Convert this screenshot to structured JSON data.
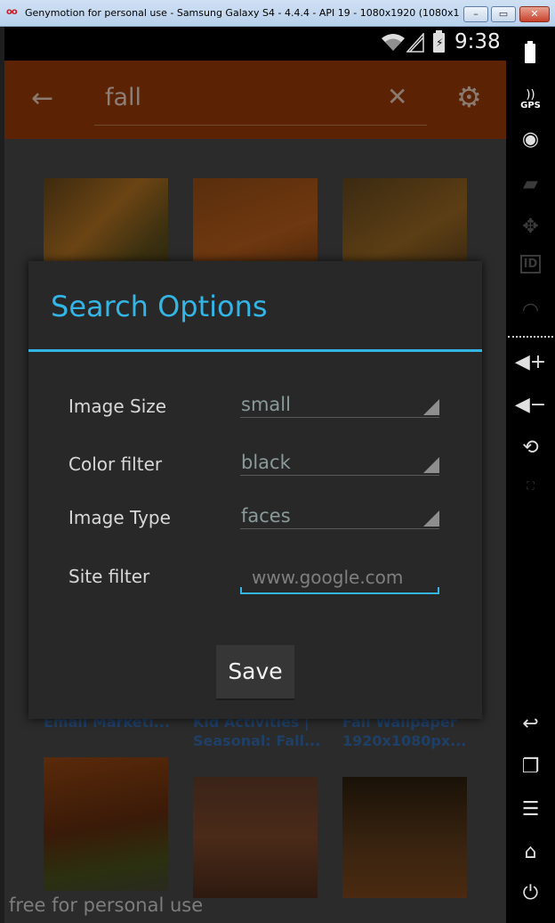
{
  "window": {
    "logo": "oo",
    "title": "Genymotion for personal use - Samsung Galaxy S4 - 4.4.4 - API 19 - 1080x1920 (1080x1920, 4...",
    "min_label": "–",
    "max_label": "▭",
    "close_label": "✕"
  },
  "status_bar": {
    "time": "9:38",
    "battery_symbol": "⚡"
  },
  "action_bar": {
    "back_icon": "←",
    "search_query": "fall",
    "clear_icon": "✕",
    "settings_icon": "⚙"
  },
  "results": {
    "captions": [
      [
        "Email Marketi..."
      ],
      [
        "Kid Activities |",
        "Seasonal: Fall..."
      ],
      [
        "Fall Wallpaper",
        "1920x1080px..."
      ]
    ]
  },
  "dialog": {
    "title": "Search Options",
    "options": [
      {
        "label": "Image Size",
        "value": "small"
      },
      {
        "label": "Color filter",
        "value": "black"
      },
      {
        "label": "Image Type",
        "value": "faces"
      }
    ],
    "site_filter": {
      "label": "Site filter",
      "placeholder": "www.google.com"
    },
    "save_label": "Save"
  },
  "sidebar": {
    "gps_label": "GPS",
    "id_label": "ID",
    "icons": [
      "battery-icon",
      "gps-icon",
      "camera-icon",
      "clapperboard-icon",
      "dpad-icon",
      "id-icon",
      "rss-icon",
      "volume-up-icon",
      "volume-down-icon",
      "rotate-icon",
      "scale-icon",
      "back-icon",
      "recent-apps-icon",
      "menu-icon",
      "home-icon",
      "power-icon"
    ]
  },
  "watermark": "free for personal use",
  "colors": {
    "accent": "#33b5e5",
    "action_bar": "#5b2303",
    "dialog_bg": "#282828"
  }
}
